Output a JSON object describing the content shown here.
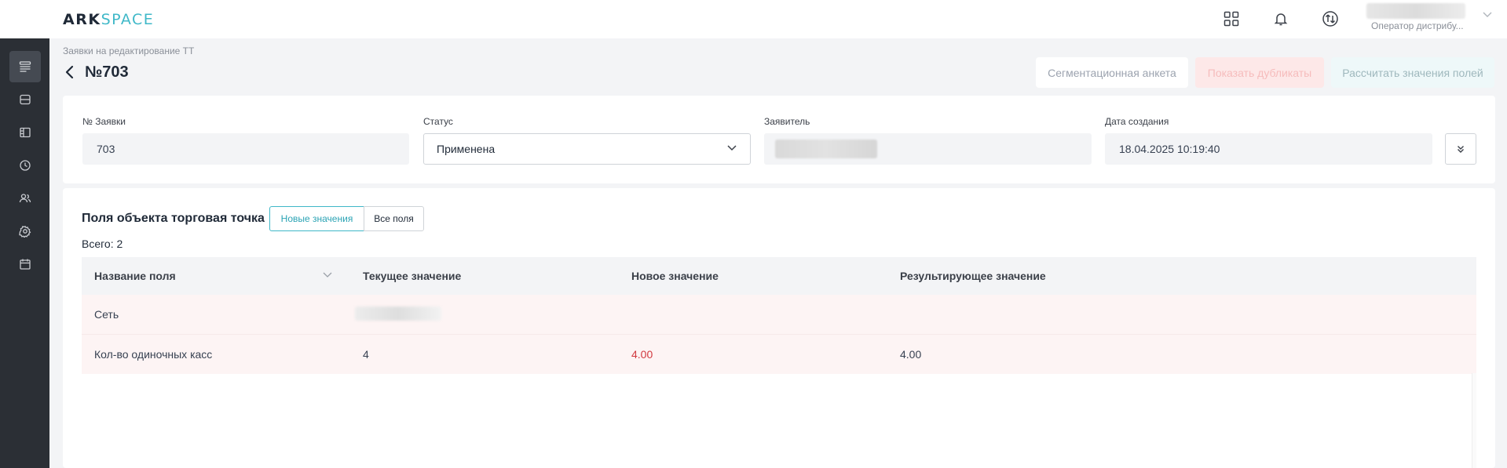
{
  "app": {
    "logo_part1": "ARK",
    "logo_part2": "SPACE",
    "user_role": "Оператор дистрибу..."
  },
  "topbar_icons": [
    "grid-icon",
    "bell-icon",
    "sync-icon"
  ],
  "sidebar": {
    "items": [
      "requests-icon",
      "database-icon",
      "layout-icon",
      "clock-icon",
      "users-icon",
      "settings-icon",
      "calendar-icon"
    ],
    "active_index": 0
  },
  "page": {
    "breadcrumb": "Заявки на редактирование ТТ",
    "title": "№703"
  },
  "actions": {
    "segmentation": "Сегментационная анкета",
    "duplicates": "Показать дубликаты",
    "calculate": "Рассчитать значения полей"
  },
  "info": {
    "request_no_label": "№ Заявки",
    "request_no_value": "703",
    "status_label": "Статус",
    "status_value": "Применена",
    "applicant_label": "Заявитель",
    "created_label": "Дата создания",
    "created_value": "18.04.2025 10:19:40"
  },
  "fields_section": {
    "title": "Поля объекта торговая точка",
    "toggle_new": "Новые значения",
    "toggle_all": "Все поля",
    "total": "Всего: 2",
    "columns": [
      "Название поля",
      "Текущее значение",
      "Новое значение",
      "Результирующее значение"
    ],
    "rows": [
      {
        "name": "Сеть",
        "current": "",
        "new": "",
        "result": ""
      },
      {
        "name": "Кол-во одиночных касс",
        "current": "4",
        "new": "4.00",
        "result": "4.00"
      }
    ]
  },
  "colors": {
    "accent": "#3fb8c8",
    "sidebar_bg": "#2b2f35",
    "new_value_red": "#d1393f",
    "row_highlight": "#fdf4f4"
  }
}
